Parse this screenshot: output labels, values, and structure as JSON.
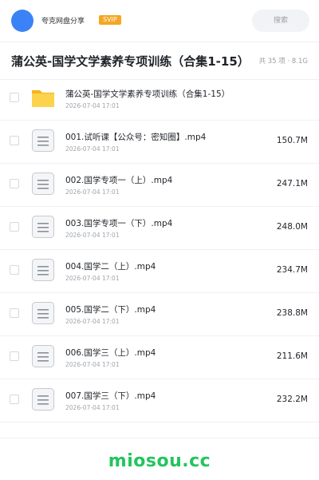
{
  "header": {
    "user_name": "夸克网盘分享",
    "badge": "SVIP",
    "search_label": "搜索"
  },
  "share": {
    "title": "蒲公英-国学文学素养专项训练（合集1-15）",
    "meta": "共 35 项 · 8.1G"
  },
  "files": [
    {
      "name": "蒲公英-国学文学素养专项训练（合集1-15）",
      "date": "2026-07-04 17:01",
      "size": "",
      "icon": "folder-icon"
    },
    {
      "name": "001.试听课【公众号：密知圈】.mp4",
      "date": "2026-07-04 17:01",
      "size": "150.7M",
      "icon": "video-file-icon"
    },
    {
      "name": "002.国学专项一（上）.mp4",
      "date": "2026-07-04 17:01",
      "size": "247.1M",
      "icon": "video-file-icon"
    },
    {
      "name": "003.国学专项一（下）.mp4",
      "date": "2026-07-04 17:01",
      "size": "248.0M",
      "icon": "video-file-icon"
    },
    {
      "name": "004.国学二（上）.mp4",
      "date": "2026-07-04 17:01",
      "size": "234.7M",
      "icon": "video-file-icon"
    },
    {
      "name": "005.国学二（下）.mp4",
      "date": "2026-07-04 17:01",
      "size": "238.8M",
      "icon": "video-file-icon"
    },
    {
      "name": "006.国学三（上）.mp4",
      "date": "2026-07-04 17:01",
      "size": "211.6M",
      "icon": "video-file-icon"
    },
    {
      "name": "007.国学三（下）.mp4",
      "date": "2026-07-04 17:01",
      "size": "232.2M",
      "icon": "video-file-icon"
    }
  ],
  "footer": {
    "watermark": "miosou.cc"
  },
  "colors": {
    "avatar": "#3b82f6",
    "badge": "#f6a623",
    "folder": "#fbbf24",
    "watermark": "#22c55e"
  }
}
